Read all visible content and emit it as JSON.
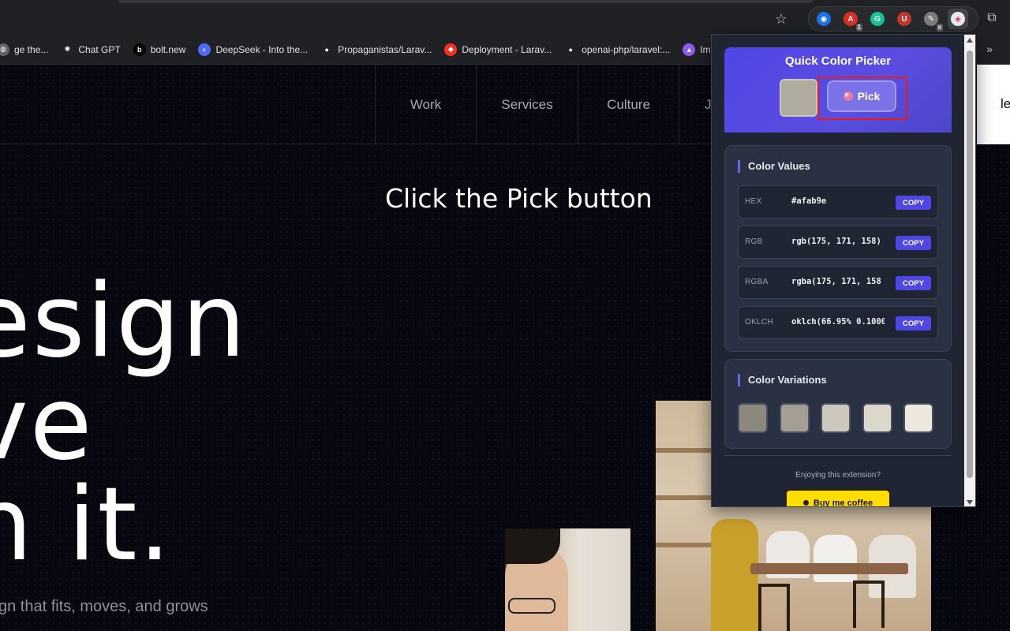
{
  "bookmarks": [
    {
      "label": "ge the...",
      "icon": "globe-icon",
      "color": "#5f6368"
    },
    {
      "label": "Chat GPT",
      "icon": "openai-icon",
      "color": "#202124"
    },
    {
      "label": "bolt.new",
      "icon": "bolt-icon",
      "color": "#000000"
    },
    {
      "label": "DeepSeek - Into the...",
      "icon": "deepseek-icon",
      "color": "#4d6bfe"
    },
    {
      "label": "Propaganistas/Larav...",
      "icon": "github-icon",
      "color": "#202124"
    },
    {
      "label": "Deployment - Larav...",
      "icon": "laravel-icon",
      "color": "#ff2d20"
    },
    {
      "label": "openai-php/laravel:...",
      "icon": "github-icon",
      "color": "#202124"
    },
    {
      "label": "Imple",
      "icon": "rocket-icon",
      "color": "#8b5cf6"
    }
  ],
  "extensions": [
    {
      "name": "blue-ext-icon",
      "color": "#1a73e8",
      "badge": ""
    },
    {
      "name": "adblock-icon",
      "color": "#d93025",
      "badge": "1"
    },
    {
      "name": "grammarly-icon",
      "color": "#15c39a",
      "badge": ""
    },
    {
      "name": "ublock-icon",
      "color": "#c0392b",
      "badge": ""
    },
    {
      "name": "puzzle-ext-icon",
      "color": "#7c7c7c",
      "badge": "x"
    },
    {
      "name": "color-picker-ext-icon",
      "color": "#e8eaed",
      "badge": ""
    }
  ],
  "site": {
    "nav": [
      "Work",
      "Services",
      "Culture",
      "J"
    ],
    "nav_cut": "le",
    "overlay_text": "Click the Pick button",
    "hero_lines": [
      "esign",
      "ve",
      "n it."
    ],
    "subtitle": "gn that fits, moves, and grows"
  },
  "popup": {
    "title": "Quick Color Picker",
    "current_color": "#afab9e",
    "pick_label": "Pick",
    "values_title": "Color Values",
    "copy_label": "COPY",
    "values": [
      {
        "label": "HEX",
        "value": "#afab9e"
      },
      {
        "label": "RGB",
        "value": "rgb(175, 171, 158)"
      },
      {
        "label": "RGBA",
        "value": "rgba(175, 171, 158"
      },
      {
        "label": "OKLCH",
        "value": "oklch(66.95% 0.1000"
      }
    ],
    "variations_title": "Color Variations",
    "variations": [
      "#8c887d",
      "#a39f93",
      "#ccc8bc",
      "#dcd8cc",
      "#ece8dc"
    ],
    "enjoy_text": "Enjoying this extension?",
    "coffee_label": "Buy me coffee"
  }
}
